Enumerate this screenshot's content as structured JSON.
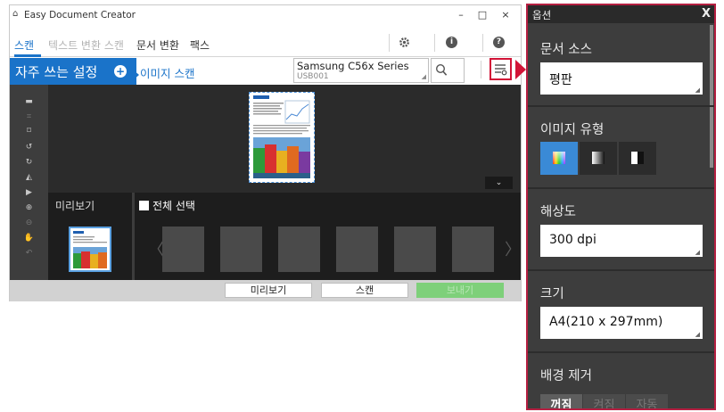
{
  "window": {
    "title": "Easy Document Creator",
    "controls": {
      "minimize": "–",
      "maximize": "□",
      "close": "×"
    }
  },
  "menu": {
    "items": [
      {
        "label": "스캔",
        "state": "active"
      },
      {
        "label": "텍스트 변환 스캔",
        "state": "disabled"
      },
      {
        "label": "문서 변환",
        "state": "normal"
      },
      {
        "label": "팩스",
        "state": "normal"
      }
    ],
    "icons": [
      "gear-icon",
      "info-icon",
      "help-icon"
    ],
    "info_glyph": "i",
    "help_glyph": "?"
  },
  "actionbar": {
    "favorites_label": "자주 쓰는 설정",
    "favorites_add": "+",
    "image_scan_label": "이미지 스캔",
    "device_name": "Samsung C56x Series",
    "device_port": "USB001"
  },
  "strip": {
    "preview_label": "미리보기",
    "select_all_label": "전체 선택",
    "expand_glyph": "⌄",
    "prev_arrow": "〈",
    "next_arrow": "〉"
  },
  "bottom": {
    "preview_button": "미리보기",
    "scan_button": "스캔",
    "send_button": "보내기"
  },
  "options": {
    "title": "옵션",
    "close": "X",
    "document_source": {
      "label": "문서 소스",
      "value": "평판"
    },
    "image_type": {
      "label": "이미지 유형",
      "options": [
        "color",
        "grayscale",
        "black-white"
      ],
      "selected": "color"
    },
    "resolution": {
      "label": "해상도",
      "value": "300 dpi"
    },
    "size": {
      "label": "크기",
      "value": "A4(210 x 297mm)"
    },
    "background_removal": {
      "label": "배경 제거",
      "options": [
        "꺼짐",
        "켜짐",
        "자동"
      ],
      "selected": "꺼짐"
    }
  },
  "colors": {
    "accent": "#1a73c9",
    "highlight": "#d21437",
    "panel": "#3d3d3d",
    "send_disabled": "#7ed07a"
  }
}
